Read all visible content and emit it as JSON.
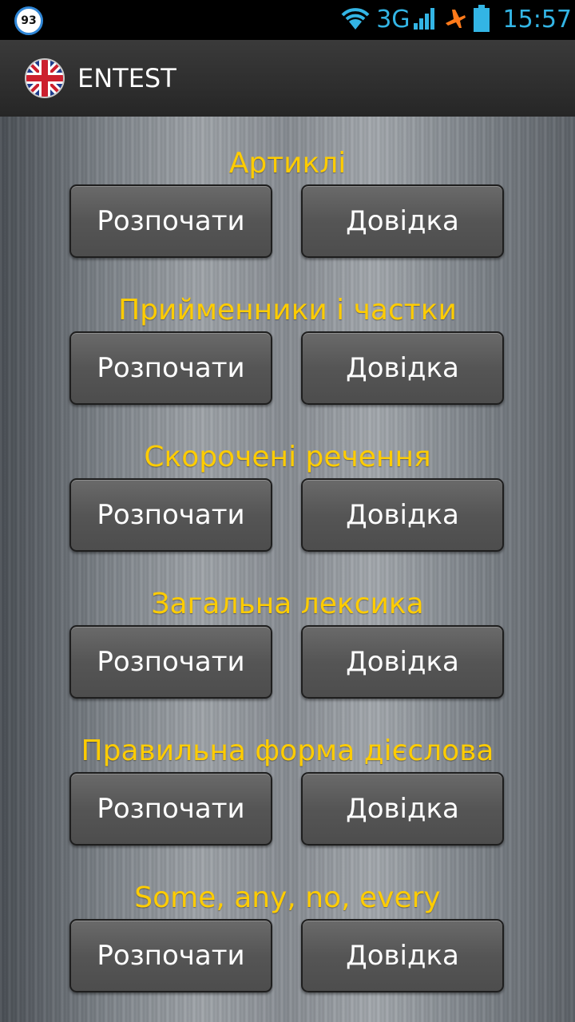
{
  "status_bar": {
    "notification_count": "93",
    "network_type": "3G",
    "time": "15:57",
    "accent_color": "#33b5e5"
  },
  "action_bar": {
    "title": "ENTEST",
    "logo_icon": "uk-flag-icon"
  },
  "colors": {
    "section_title": "#ffcc00",
    "button_text": "#ffffff"
  },
  "sections": [
    {
      "title": "Артиклі",
      "start_label": "Розпочати",
      "help_label": "Довідка"
    },
    {
      "title": "Прийменники і частки",
      "start_label": "Розпочати",
      "help_label": "Довідка"
    },
    {
      "title": "Скорочені речення",
      "start_label": "Розпочати",
      "help_label": "Довідка"
    },
    {
      "title": "Загальна лексика",
      "start_label": "Розпочати",
      "help_label": "Довідка"
    },
    {
      "title": "Правильна форма дієслова",
      "start_label": "Розпочати",
      "help_label": "Довідка"
    },
    {
      "title": "Some, any, no, every",
      "start_label": "Розпочати",
      "help_label": "Довідка"
    }
  ]
}
